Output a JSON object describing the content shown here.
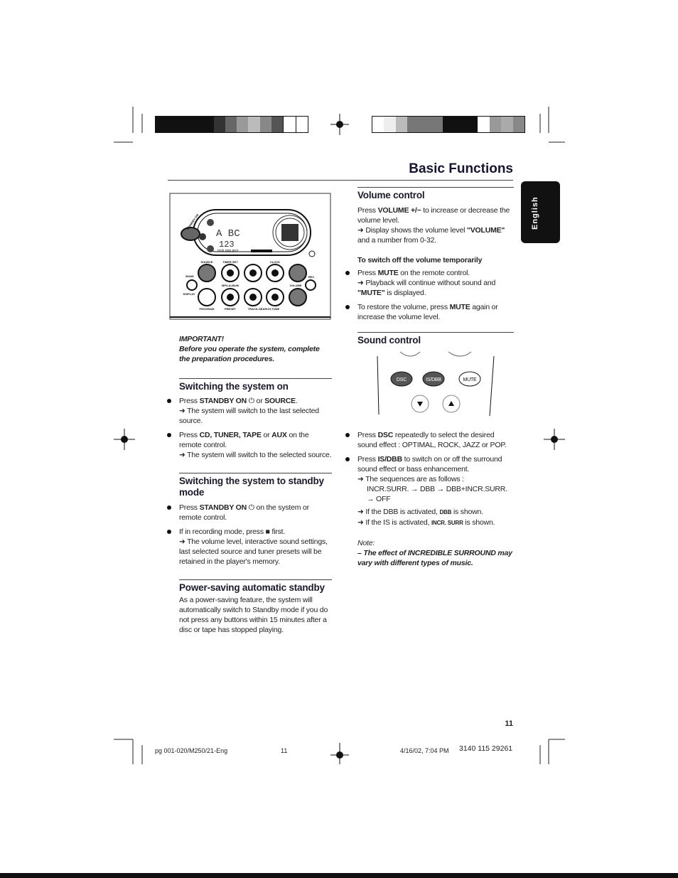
{
  "header": {
    "title": "Basic Functions",
    "language_tab": "English"
  },
  "left": {
    "important_label": "IMPORTANT!",
    "important_text": "Before you operate the system, complete the preparation procedures.",
    "switching_on": {
      "heading": "Switching the system on",
      "b1": [
        "Press ",
        "STANDBY ON",
        " ⏻ or ",
        "SOURCE",
        "."
      ],
      "b1_result": "➜ The system will switch to the last selected source.",
      "b2": [
        "Press ",
        "CD, TUNER, TAPE",
        " or ",
        "AUX",
        " on the remote control."
      ],
      "b2_result": "➜ The system will switch to the selected source."
    },
    "standby": {
      "heading": "Switching the system to standby mode",
      "b1": [
        "Press ",
        "STANDBY ON",
        " ⏻ on the system or remote control."
      ],
      "b2": "If in recording mode, press ■ first.",
      "b2_result": "➜ The volume level, interactive sound settings, last selected source and tuner presets will be retained in the player's memory."
    },
    "power_saving": {
      "heading": "Power-saving automatic standby",
      "text": "As a power-saving feature, the system will automatically switch to Standby mode if you do not press any buttons within 15 minutes after a disc or tape has stopped playing."
    }
  },
  "right": {
    "volume": {
      "heading": "Volume control",
      "p1": [
        "Press ",
        "VOLUME +/−",
        " to increase or decrease the volume level."
      ],
      "p1_result": [
        "➜ Display shows the volume level ",
        "\"VOLUME\"",
        " and a number from 0-32."
      ],
      "sub": "To switch off the volume temporarily",
      "b1": [
        "Press ",
        "MUTE",
        " on the remote control."
      ],
      "b1_result": [
        "➜ Playback will continue without sound and ",
        "\"MUTE\"",
        " is displayed."
      ],
      "b2": [
        "To restore the volume, press ",
        "MUTE",
        " again or increase the volume level."
      ]
    },
    "sound": {
      "heading": "Sound control",
      "b1": [
        "Press ",
        "DSC",
        " repeatedly to select the desired sound effect : ",
        "OPTIMAL, ROCK, JAZZ",
        " or ",
        "POP",
        "."
      ],
      "b2": [
        "Press ",
        "IS/DBB",
        " to switch on or off the surround sound effect or bass enhancement."
      ],
      "b2_r1": "➜ The sequences are as follows :",
      "b2_r2": "INCR.SURR. → DBB → DBB+INCR.SURR. → OFF",
      "b2_r3": [
        "➜ If the DBB is activated, ",
        "DBB",
        " is shown."
      ],
      "b2_r4": [
        "➜ If the IS is activated, ",
        "INCR. SURR",
        " is shown."
      ],
      "note_label": "Note:",
      "note_text": "– The effect of INCREDIBLE SURROUND may vary with different types of music."
    }
  },
  "device_panel": {
    "labels": [
      "SOURCE",
      "TIMER SET",
      "CLOCK",
      "BAND",
      "REC",
      "MP3-ALBUM",
      "VOLUME",
      "DISPLAY",
      "PROGRAM",
      "PRESET",
      "TRACK-SEARCH-TUNE",
      "STANDBY ON"
    ],
    "display": [
      "A BC",
      "123",
      "rock pop jazz"
    ]
  },
  "remote_buttons": [
    "DSC",
    "IS/DBB",
    "MUTE"
  ],
  "page_number": "11",
  "footer": {
    "file": "pg 001-020/M250/21-Eng",
    "page": "11",
    "date": "4/16/02, 7:04 PM",
    "code": "3140 115 29261"
  }
}
